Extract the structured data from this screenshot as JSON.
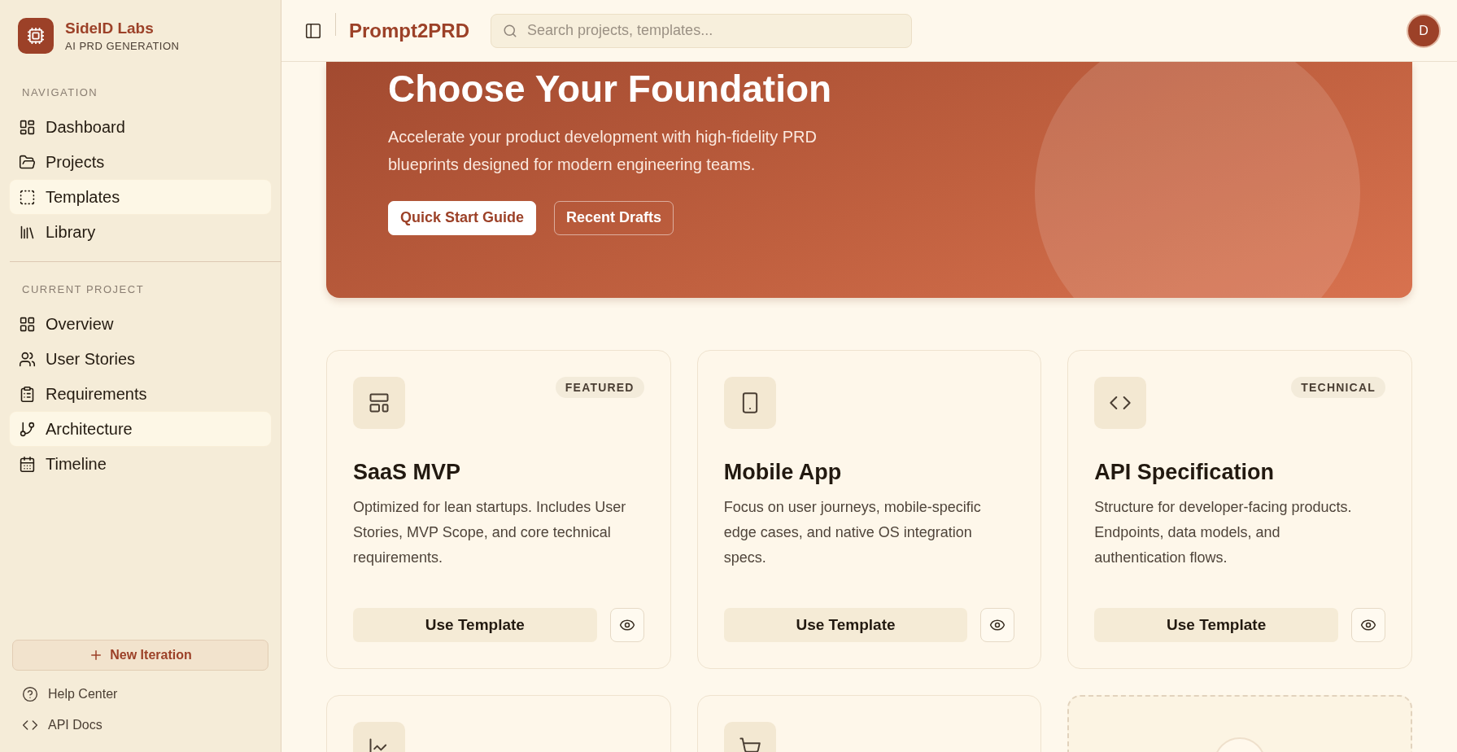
{
  "brand": {
    "name": "SideID Labs",
    "tagline": "AI PRD GENERATION"
  },
  "navigation": {
    "heading": "NAVIGATION",
    "items": [
      {
        "label": "Dashboard",
        "selected": false
      },
      {
        "label": "Projects",
        "selected": false
      },
      {
        "label": "Templates",
        "selected": true
      },
      {
        "label": "Library",
        "selected": false
      }
    ]
  },
  "current_project": {
    "heading": "CURRENT PROJECT",
    "items": [
      {
        "label": "Overview",
        "selected": false
      },
      {
        "label": "User Stories",
        "selected": false
      },
      {
        "label": "Requirements",
        "selected": false
      },
      {
        "label": "Architecture",
        "selected": true
      },
      {
        "label": "Timeline",
        "selected": false
      }
    ]
  },
  "new_iteration_button": "New Iteration",
  "footer_links": [
    "Help Center",
    "API Docs"
  ],
  "header": {
    "app_title": "Prompt2PRD",
    "search": {
      "placeholder": "Search projects, templates..."
    },
    "avatar": "D"
  },
  "hero": {
    "title": "Choose Your Foundation",
    "subtitle": "Accelerate your product development with high-fidelity PRD blueprints designed for modern engineering teams.",
    "buttons": [
      {
        "label": "Quick Start Guide",
        "kind": "primary"
      },
      {
        "label": "Recent Drafts",
        "kind": "outline"
      }
    ]
  },
  "templates": [
    {
      "kind": "template",
      "badge": "FEATURED",
      "title": "SaaS MVP",
      "description": "Optimized for lean startups. Includes User Stories, MVP Scope, and core technical requirements.",
      "action": "Use Template"
    },
    {
      "kind": "template",
      "title": "Mobile App",
      "description": "Focus on user journeys, mobile-specific edge cases, and native OS integration specs.",
      "action": "Use Template"
    },
    {
      "kind": "template",
      "badge": "TECHNICAL",
      "title": "API Specification",
      "description": "Structure for developer-facing products. Endpoints, data models, and authentication flows.",
      "action": "Use Template"
    },
    {
      "kind": "template"
    },
    {
      "kind": "template"
    },
    {
      "kind": "add"
    }
  ]
}
